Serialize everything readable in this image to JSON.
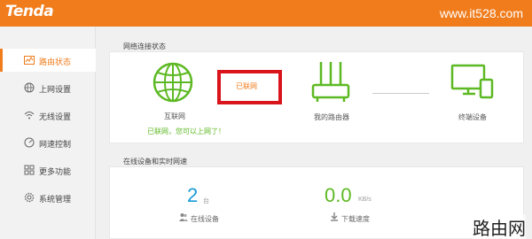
{
  "header": {
    "logo": "Tenda",
    "site_url": "www.it528.com"
  },
  "sidebar": {
    "items": [
      {
        "label": "路由状态",
        "icon": "status-icon",
        "active": true
      },
      {
        "label": "上网设置",
        "icon": "globe-icon"
      },
      {
        "label": "无线设置",
        "icon": "wifi-icon"
      },
      {
        "label": "网速控制",
        "icon": "speed-icon"
      },
      {
        "label": "更多功能",
        "icon": "grid-icon"
      },
      {
        "label": "系统管理",
        "icon": "gear-icon"
      }
    ]
  },
  "network_status": {
    "title": "网络连接状态",
    "internet_label": "互联网",
    "connection_status": "已联网",
    "connected_message": "已联网，您可以上网了！",
    "router_label": "我的路由器",
    "clients_label": "终端设备"
  },
  "devices": {
    "title": "在线设备和实时网速",
    "online_count": "2",
    "online_unit": "台",
    "online_label": "在线设备",
    "download_speed": "0.0",
    "speed_unit": "KB/s",
    "download_label": "下载速度"
  },
  "colors": {
    "accent": "#f07c1c",
    "green": "#5db923",
    "blue": "#1a9bd7",
    "alert": "#d9141a"
  },
  "watermark": "路由网"
}
